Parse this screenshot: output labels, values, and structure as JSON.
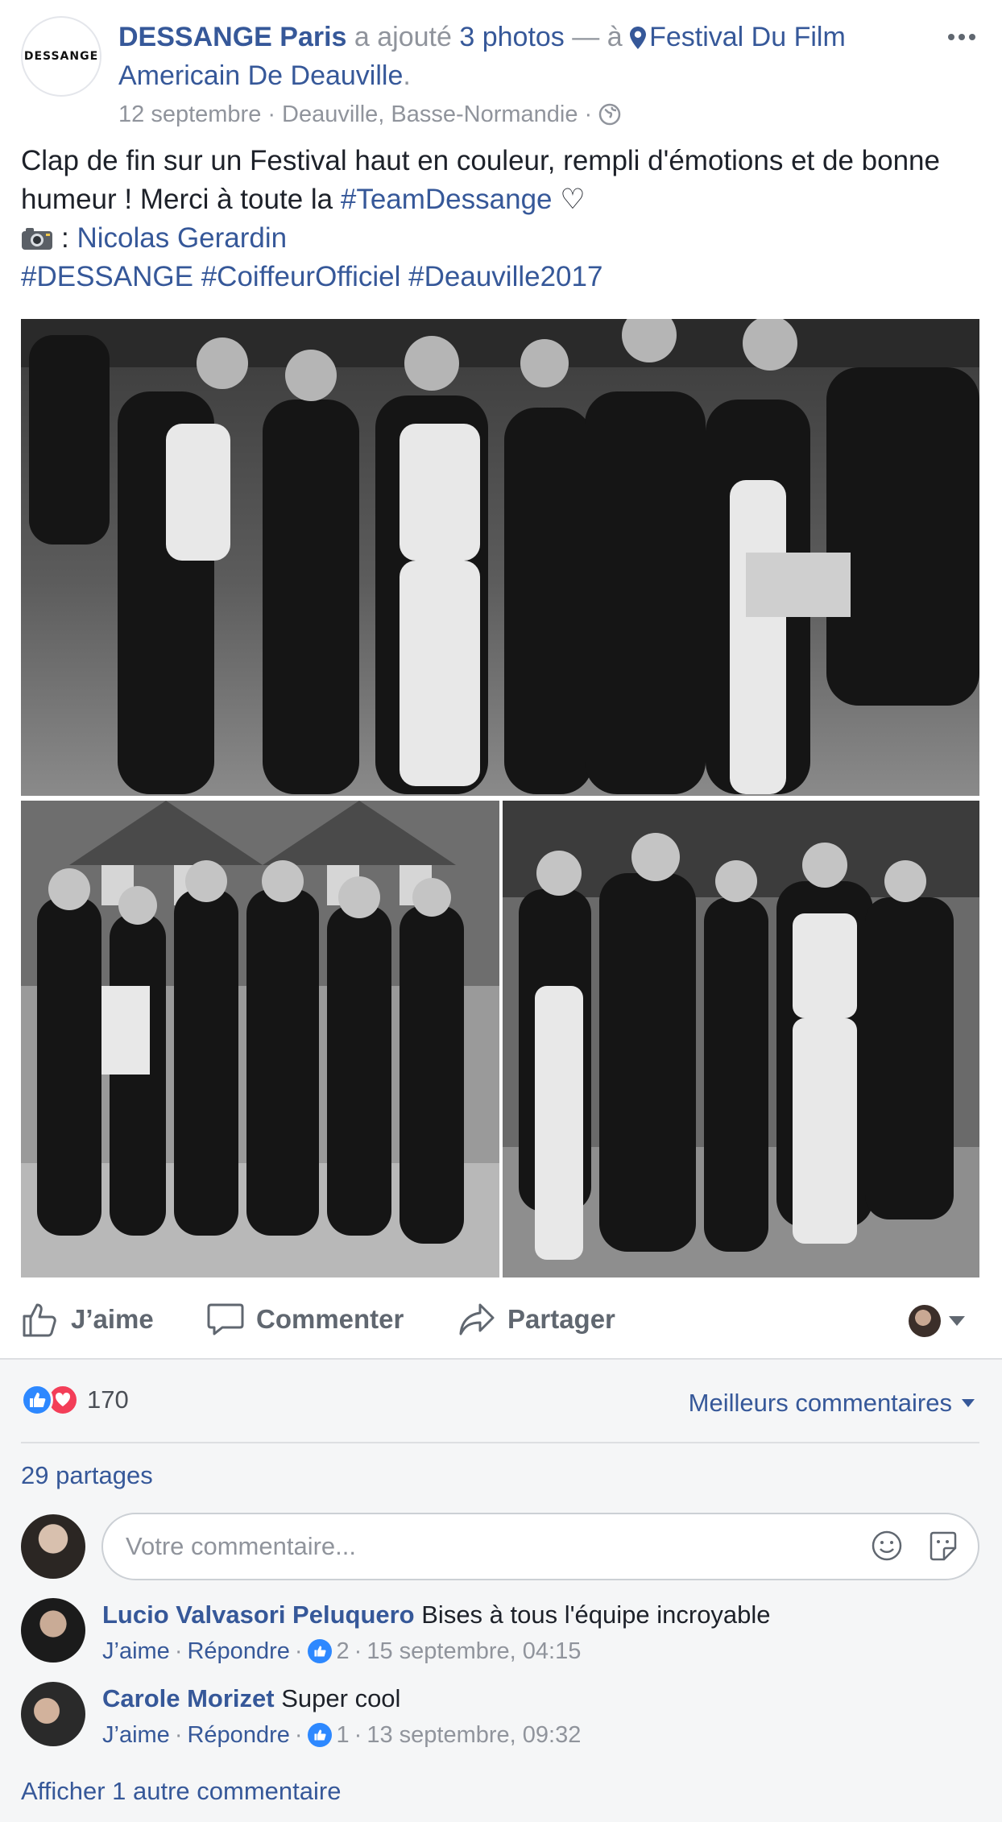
{
  "post": {
    "author": "DESSANGE Paris",
    "avatar_text": "DESSANGE",
    "added": "a ajouté",
    "photos_link": "3 photos",
    "dash_at": "— à",
    "location": "Festival Du Film Americain De Deauville",
    "period": ".",
    "date": "12 septembre",
    "place": "Deauville, Basse-Normandie",
    "sep": "·",
    "audience_icon": "globe-icon",
    "text_line1": "Clap de fin sur un Festival haut en couleur, rempli d'émotions et de bonne humeur ! Merci à toute la",
    "hashtag_team": "#TeamDessange",
    "heart": "♡",
    "photo_credit_colon": ":",
    "photographer": "Nicolas Gerardin",
    "hashtags": [
      "#DESSANGE",
      "#CoiffeurOfficiel",
      "#Deauville2017"
    ]
  },
  "actions": {
    "like": "J’aime",
    "comment": "Commenter",
    "share": "Partager"
  },
  "stats": {
    "reaction_count": "170",
    "sort_label": "Meilleurs commentaires",
    "shares": "29 partages"
  },
  "composer": {
    "placeholder": "Votre commentaire..."
  },
  "comments": [
    {
      "name": "Lucio Valvasori Peluquero",
      "text": "Bises à tous l'équipe incroyable",
      "like": "J’aime",
      "reply": "Répondre",
      "likes": "2",
      "time": "15 septembre, 04:15"
    },
    {
      "name": "Carole Morizet",
      "text": "Super cool",
      "like": "J’aime",
      "reply": "Répondre",
      "likes": "1",
      "time": "13 septembre, 09:32"
    }
  ],
  "more_comments": "Afficher 1 autre commentaire",
  "colors": {
    "link": "#365899",
    "meta": "#90949c",
    "like_blue": "#2d88ff",
    "love_red": "#f33e58"
  }
}
